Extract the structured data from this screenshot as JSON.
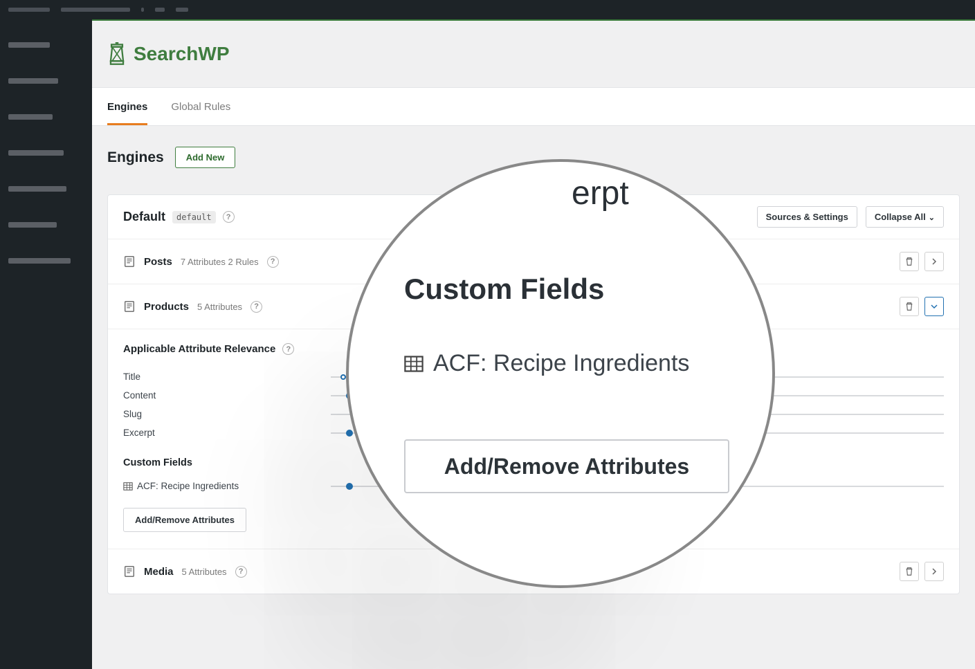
{
  "brand": {
    "name": "SearchWP"
  },
  "tabs": [
    {
      "label": "Engines",
      "active": true
    },
    {
      "label": "Global Rules",
      "active": false
    }
  ],
  "engines_section": {
    "title": "Engines",
    "add_new_label": "Add New"
  },
  "engine": {
    "name": "Default",
    "tag": "default",
    "sources_settings_label": "Sources & Settings",
    "collapse_all_label": "Collapse All"
  },
  "sources": {
    "posts": {
      "name": "Posts",
      "meta": "7 Attributes 2 Rules"
    },
    "products": {
      "name": "Products",
      "meta": "5 Attributes"
    },
    "media": {
      "name": "Media",
      "meta": "5 Attributes"
    }
  },
  "attributes_section": {
    "heading": "Applicable Attribute Relevance",
    "items": [
      {
        "label": "Title"
      },
      {
        "label": "Content"
      },
      {
        "label": "Slug"
      },
      {
        "label": "Excerpt"
      }
    ],
    "custom_fields_heading": "Custom Fields",
    "custom_fields": [
      {
        "label": "ACF: Recipe Ingredients"
      }
    ],
    "add_remove_label": "Add/Remove Attributes"
  },
  "magnifier": {
    "partial_word": "erpt",
    "heading": "Custom Fields",
    "field_label": "ACF: Recipe Ingredients",
    "button_label": "Add/Remove Attributes"
  }
}
